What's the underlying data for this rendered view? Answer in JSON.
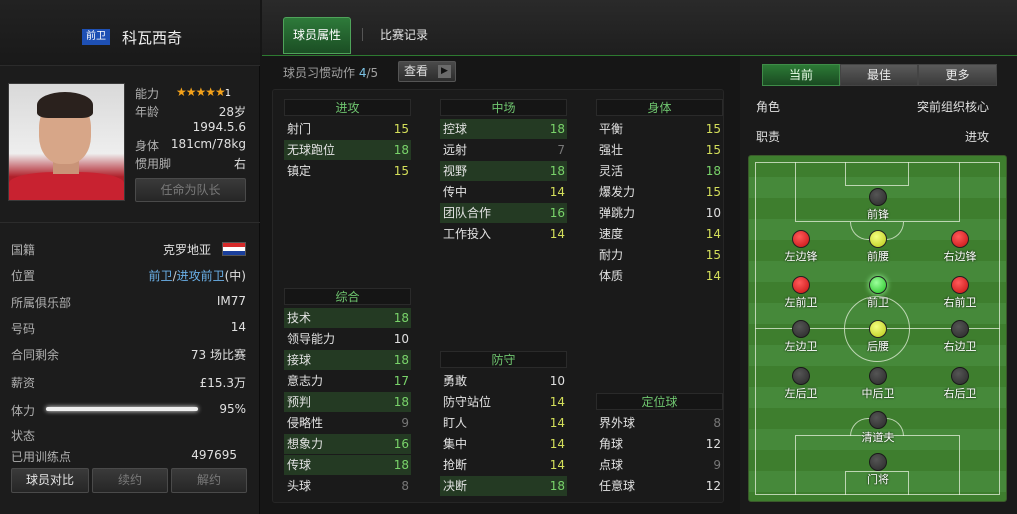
{
  "player": {
    "position_badge": "前卫",
    "name": "科瓦西奇"
  },
  "info_top": {
    "ability_label": "能力",
    "ability_stars": "★★★★★",
    "ability_suffix": "1",
    "age_label": "年龄",
    "age": "28岁",
    "birth": "1994.5.6",
    "body_label": "身体",
    "body": "181cm/78kg",
    "foot_label": "惯用脚",
    "foot": "右",
    "captain_button": "任命为队长"
  },
  "details": {
    "nationality_label": "国籍",
    "nationality": "克罗地亚",
    "position_label": "位置",
    "position_a": "前卫",
    "position_slash": "/",
    "position_b": "进攻前卫",
    "position_c": "(中)",
    "club_label": "所属俱乐部",
    "club": "IM77",
    "number_label": "号码",
    "number": "14",
    "contract_label": "合同剩余",
    "contract": "73 场比赛",
    "salary_label": "薪资",
    "salary": "£15.3万",
    "stamina_label": "体力",
    "stamina": "95%",
    "stamina_fraction": 0.95,
    "status_label": "状态",
    "training_label": "已用训练点",
    "training": "497695"
  },
  "bottom_buttons": {
    "compare": "球员对比",
    "renew": "续约",
    "release": "解约"
  },
  "tabs": {
    "attrs": "球员属性",
    "records": "比赛记录"
  },
  "habit": {
    "label": "球员习惯动作",
    "value": "4",
    "slash": "/",
    "total": "5",
    "view_button": "查看"
  },
  "groups": {
    "attack": {
      "title": "进攻",
      "rows": [
        [
          "射门",
          "15"
        ],
        [
          "无球跑位",
          "18"
        ],
        [
          "镇定",
          "15"
        ]
      ]
    },
    "midfield": {
      "title": "中场",
      "rows": [
        [
          "控球",
          "18"
        ],
        [
          "远射",
          "7"
        ],
        [
          "视野",
          "18"
        ],
        [
          "传中",
          "14"
        ],
        [
          "团队合作",
          "16"
        ],
        [
          "工作投入",
          "14"
        ]
      ]
    },
    "physical": {
      "title": "身体",
      "rows": [
        [
          "平衡",
          "15"
        ],
        [
          "强壮",
          "15"
        ],
        [
          "灵活",
          "18"
        ],
        [
          "爆发力",
          "15"
        ],
        [
          "弹跳力",
          "10"
        ],
        [
          "速度",
          "14"
        ],
        [
          "耐力",
          "15"
        ],
        [
          "体质",
          "14"
        ]
      ]
    },
    "general": {
      "title": "综合",
      "rows": [
        [
          "技术",
          "18"
        ],
        [
          "领导能力",
          "10"
        ],
        [
          "接球",
          "18"
        ],
        [
          "意志力",
          "17"
        ],
        [
          "预判",
          "18"
        ],
        [
          "侵略性",
          "9"
        ],
        [
          "想象力",
          "16"
        ],
        [
          "传球",
          "18"
        ],
        [
          "头球",
          "8"
        ]
      ]
    },
    "defense": {
      "title": "防守",
      "rows": [
        [
          "勇敢",
          "10"
        ],
        [
          "防守站位",
          "14"
        ],
        [
          "盯人",
          "14"
        ],
        [
          "集中",
          "14"
        ],
        [
          "抢断",
          "14"
        ],
        [
          "决断",
          "18"
        ]
      ]
    },
    "setpiece": {
      "title": "定位球",
      "rows": [
        [
          "界外球",
          "8"
        ],
        [
          "角球",
          "12"
        ],
        [
          "点球",
          "9"
        ],
        [
          "任意球",
          "12"
        ]
      ]
    }
  },
  "segments": {
    "current": "当前",
    "best": "最佳",
    "more": "更多"
  },
  "role": {
    "role_label": "角色",
    "role": "突前组织核心",
    "duty_label": "职责",
    "duty": "进攻"
  },
  "pitch_positions": {
    "st": "前锋",
    "lw": "左边锋",
    "am": "前腰",
    "rw": "右边锋",
    "lm": "左前卫",
    "cm": "前卫",
    "rm": "右前卫",
    "lwb": "左边卫",
    "dm": "后腰",
    "rwb": "右边卫",
    "lb": "左后卫",
    "cb": "中后卫",
    "rb": "右后卫",
    "sw": "清道夫",
    "gk": "门将"
  },
  "colors": {
    "accent_green": "#2e7a3a",
    "value_high": "#79d36a",
    "value_mid": "#d4df5a",
    "badge_blue": "#1e50b4"
  }
}
